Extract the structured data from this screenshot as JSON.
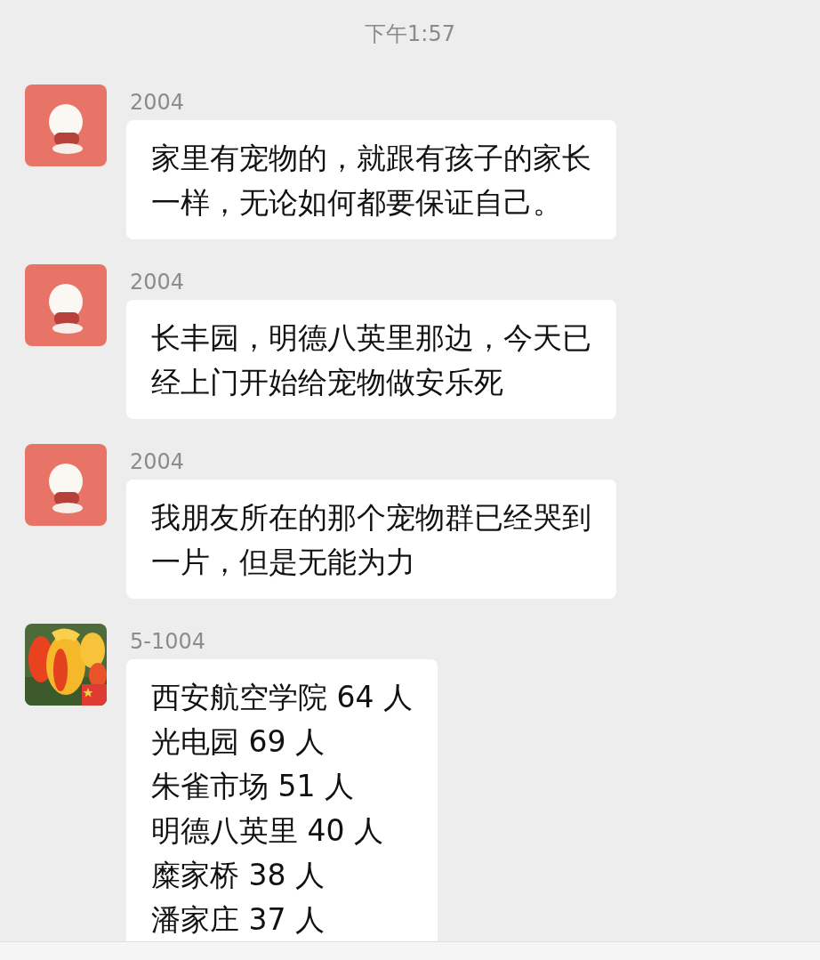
{
  "time": "下午1:57",
  "messages": [
    {
      "sender": "2004",
      "avatar": {
        "kind": "cartoon"
      },
      "lines": [
        "家里有宠物的，就跟有孩子的家长",
        "一样，无论如何都要保证自己。"
      ]
    },
    {
      "sender": "2004",
      "avatar": {
        "kind": "cartoon"
      },
      "lines": [
        "长丰园，明德八英里那边，今天已",
        "经上门开始给宠物做安乐死"
      ]
    },
    {
      "sender": "2004",
      "avatar": {
        "kind": "cartoon"
      },
      "lines": [
        "我朋友所在的那个宠物群已经哭到",
        "一片，但是无能为力"
      ]
    },
    {
      "sender": "5-1004",
      "lines": [
        "西安航空学院 64 人",
        "光电园 69 人",
        "朱雀市场 51 人",
        "明德八英里 40 人",
        "糜家桥 38 人",
        "潘家庄 37 人"
      ]
    }
  ]
}
